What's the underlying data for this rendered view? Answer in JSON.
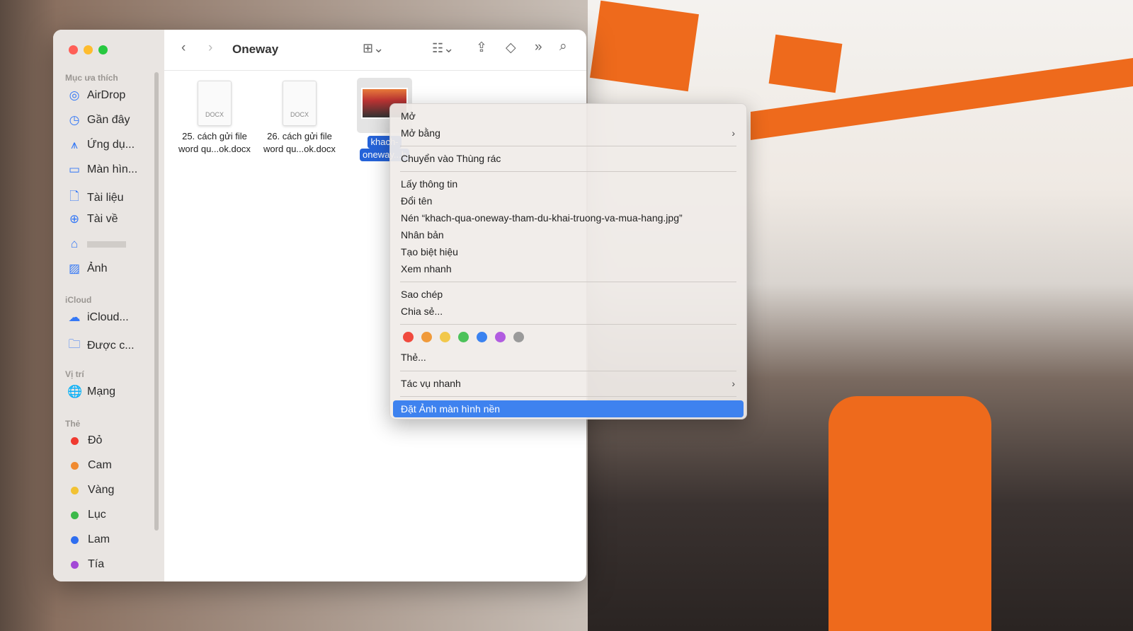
{
  "window": {
    "title": "Oneway"
  },
  "sidebar": {
    "favorites_label": "Mục ưa thích",
    "favorites": [
      {
        "icon": "airdrop-icon",
        "glyph": "◎",
        "label": "AirDrop"
      },
      {
        "icon": "clock-icon",
        "glyph": "◷",
        "label": "Gần đây"
      },
      {
        "icon": "applications-icon",
        "glyph": "⩚",
        "label": "Ứng dụ..."
      },
      {
        "icon": "desktop-icon",
        "glyph": "▭",
        "label": "Màn hìn..."
      },
      {
        "icon": "document-icon",
        "glyph": "🗋",
        "label": "Tài liệu"
      },
      {
        "icon": "download-icon",
        "glyph": "⊕",
        "label": "Tài về"
      },
      {
        "icon": "home-icon",
        "glyph": "⌂",
        "label": ""
      },
      {
        "icon": "photos-icon",
        "glyph": "▨",
        "label": "Ảnh"
      }
    ],
    "icloud_label": "iCloud",
    "icloud": [
      {
        "icon": "cloud-icon",
        "glyph": "☁",
        "label": "iCloud..."
      },
      {
        "icon": "shared-folder-icon",
        "glyph": "🗀",
        "label": "Được c..."
      }
    ],
    "locations_label": "Vị trí",
    "locations": [
      {
        "icon": "network-icon",
        "glyph": "🌐",
        "label": "Mạng"
      }
    ],
    "tags_label": "Thẻ",
    "tags": [
      {
        "label": "Đỏ",
        "color": "#f03a30"
      },
      {
        "label": "Cam",
        "color": "#f08a30"
      },
      {
        "label": "Vàng",
        "color": "#f2c233"
      },
      {
        "label": "Lục",
        "color": "#3cb94a"
      },
      {
        "label": "Lam",
        "color": "#2f6ef0"
      },
      {
        "label": "Tía",
        "color": "#a348d6"
      }
    ]
  },
  "files": [
    {
      "type": "DOCX",
      "line1": "25. cách gửi file",
      "line2": "word qu...ok.docx"
    },
    {
      "type": "DOCX",
      "line1": "26. cách gửi file",
      "line2": "word qu...ok.docx"
    },
    {
      "type": "jpg",
      "line1": "khach-",
      "line2": "oneway...h"
    }
  ],
  "menu": {
    "items": [
      "Mở",
      "Mở bằng",
      "Chuyển vào Thùng rác",
      "Lấy thông tin",
      "Đổi tên",
      "Nén “khach-qua-oneway-tham-du-khai-truong-va-mua-hang.jpg”",
      "Nhân bản",
      "Tạo biệt hiệu",
      "Xem nhanh",
      "Sao chép",
      "Chia sẻ...",
      "Thẻ...",
      "Tác vụ nhanh",
      "Đặt Ảnh màn hình nền"
    ],
    "tag_colors": [
      "#f04a3e",
      "#f09a3a",
      "#f2c84a",
      "#4cc25a",
      "#3a82f0",
      "#b15ce0",
      "#9a9a9a"
    ],
    "highlighted": "Đặt Ảnh màn hình nền"
  }
}
